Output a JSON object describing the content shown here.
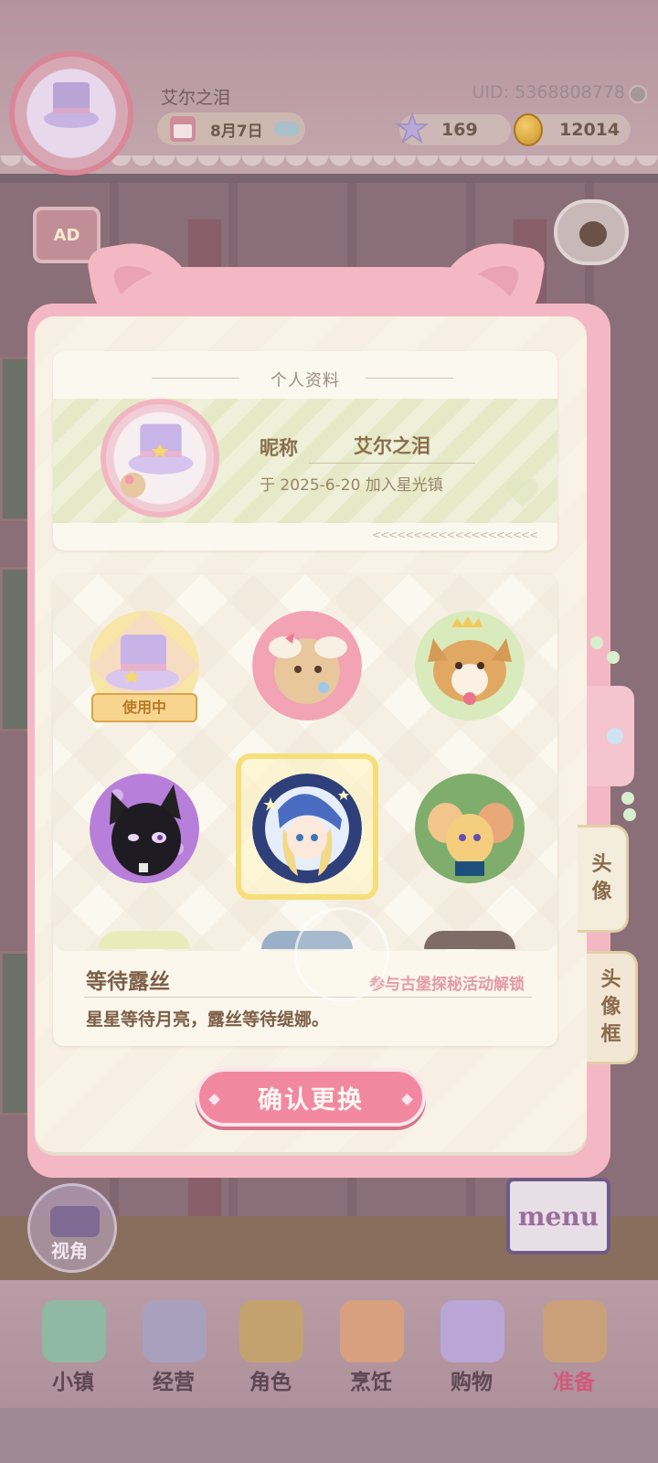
{
  "header": {
    "nickname": "艾尔之泪",
    "date": "8月7日",
    "uid": "UID: 5368808778",
    "stars": "169",
    "coins": "12014"
  },
  "floating": {
    "ad_label": "AD",
    "view_label": "视角",
    "menu_label": "menu"
  },
  "profile": {
    "section_title": "个人资料",
    "nick_label": "昵称",
    "nick_value": "艾尔之泪",
    "join_text": "于 2025-6-20 加入星光镇",
    "arrows": "<<<<<<<<<<<<<<<<<<<<"
  },
  "avatars": {
    "in_use_label": "使用中",
    "items": [
      {
        "name": "purple-hat",
        "state": "in-use"
      },
      {
        "name": "deer-girl",
        "state": "owned"
      },
      {
        "name": "corgi-king",
        "state": "owned"
      },
      {
        "name": "black-cat",
        "state": "owned"
      },
      {
        "name": "moon-girl",
        "state": "selected"
      },
      {
        "name": "group-friends",
        "state": "owned"
      }
    ]
  },
  "detail": {
    "title": "等待露丝",
    "unlock_hint": "参与古堡探秘活动解锁",
    "description": "星星等待月亮，露丝等待缇娜。"
  },
  "confirm_label": "确认更换",
  "tabs": {
    "avatar": [
      "头",
      "像"
    ],
    "frame": [
      "头",
      "像",
      "框"
    ]
  },
  "nav": [
    {
      "label": "小镇",
      "icon": "map-icon",
      "color": "#8fb9a4"
    },
    {
      "label": "经营",
      "icon": "shop-bag-icon",
      "color": "#a9a0bd"
    },
    {
      "label": "角色",
      "icon": "character-icon",
      "color": "#c3a26f"
    },
    {
      "label": "烹饪",
      "icon": "burger-icon",
      "color": "#d9a080"
    },
    {
      "label": "购物",
      "icon": "shopping-bag-icon",
      "color": "#b9a6d6"
    },
    {
      "label": "准备",
      "icon": "basket-icon",
      "color": "#c9a079",
      "active": true
    }
  ],
  "colors": {
    "modal_pink": "#f4b8c4",
    "confirm_pink": "#f188a0",
    "paper": "#f9f3e7",
    "selected_gold": "#f6df7a"
  }
}
